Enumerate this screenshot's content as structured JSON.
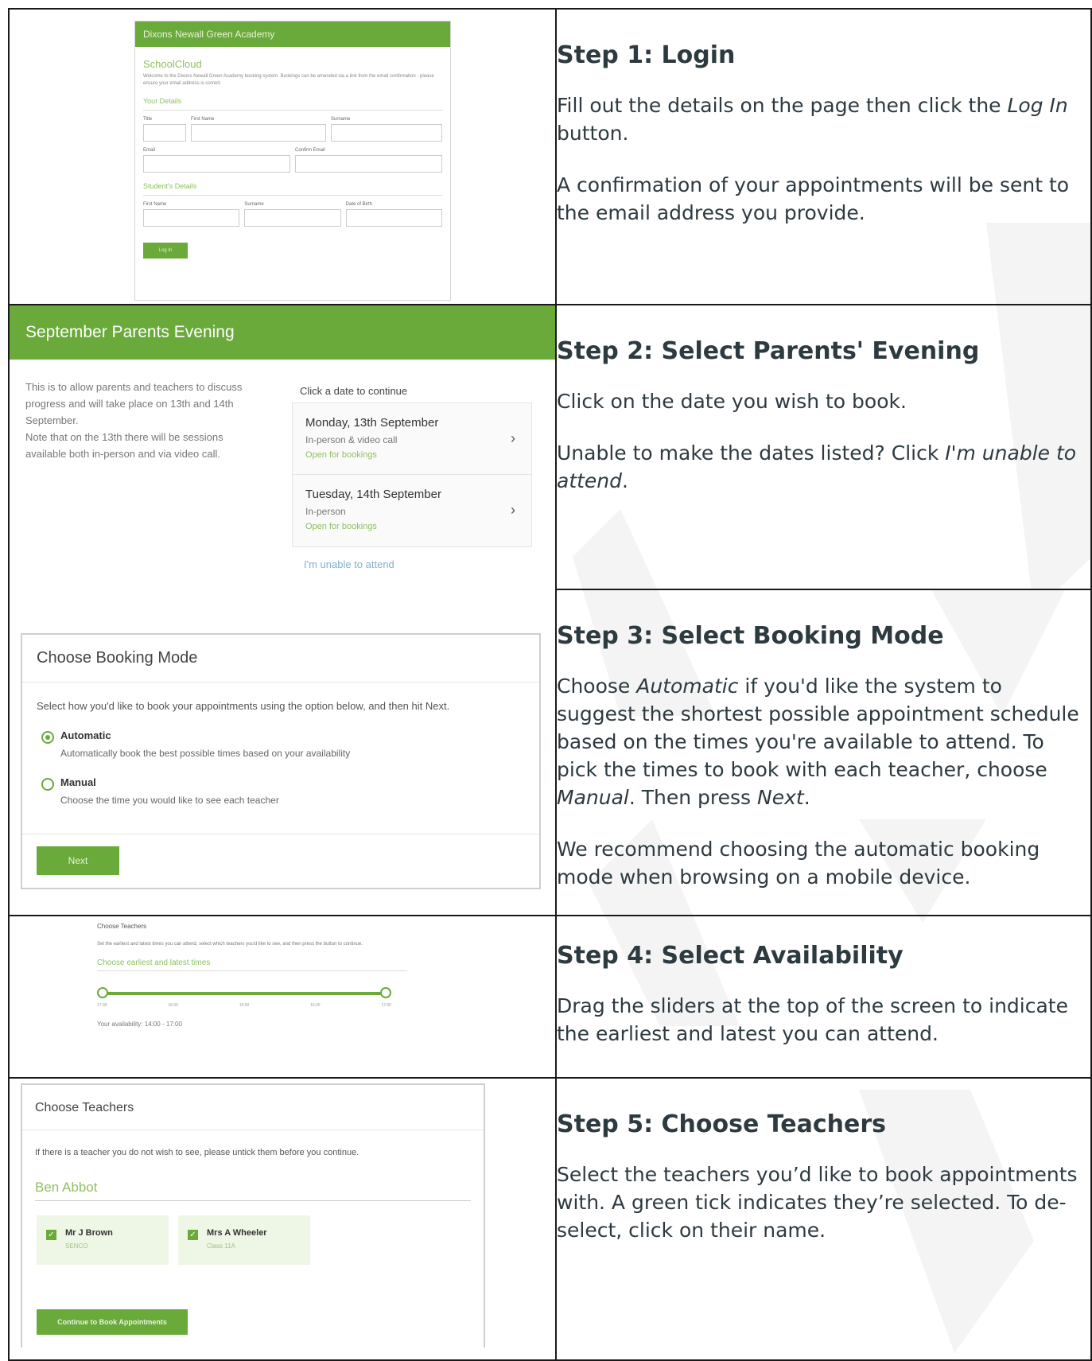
{
  "steps": [
    {
      "title": "Step 1: Login",
      "paragraphs": [
        [
          "Fill out the details on the page then click the ",
          {
            "em": "Log In"
          },
          " button."
        ],
        [
          "A confirmation of your appointments will be sent to the email address you provide."
        ]
      ]
    },
    {
      "title": "Step 2: Select Parents' Evening",
      "paragraphs": [
        [
          "Click on the date you wish to book."
        ],
        [
          "Unable to make the dates listed? Click ",
          {
            "em": "I'm unable to attend"
          },
          "."
        ]
      ]
    },
    {
      "title": "Step 3: Select Booking Mode",
      "paragraphs": [
        [
          "Choose ",
          {
            "em": "Automatic"
          },
          " if you'd like the system to suggest the shortest possible appointment schedule based on the times you're available to attend. To pick the times to book with each teacher, choose ",
          {
            "em": "Manual"
          },
          ". Then press ",
          {
            "em": "Next"
          },
          "."
        ],
        [
          "We recommend choosing the automatic booking mode when browsing on a mobile device."
        ]
      ]
    },
    {
      "title": "Step 4: Select Availability",
      "paragraphs": [
        [
          "Drag the sliders at the top of the screen to indicate the earliest and latest you can attend."
        ]
      ]
    },
    {
      "title": "Step 5: Choose Teachers",
      "paragraphs": [
        [
          "Select the teachers you’d like to book appointments with. A green tick indicates they’re selected. To de-select, click on their name."
        ]
      ]
    }
  ],
  "mock1": {
    "header": "Dixons Newall Green Academy",
    "app": "SchoolCloud",
    "welcome": "Welcome to the Dixons Newall Green Academy booking system. Bookings can be amended via a link from the email confirmation - please ensure your email address is correct.",
    "your_details": "Your Details",
    "title_label": "Title",
    "first_name_label": "First Name",
    "surname_label": "Surname",
    "email_label": "Email",
    "confirm_email_label": "Confirm Email",
    "students_details": "Student's Details",
    "student_first_label": "First Name",
    "student_surname_label": "Surname",
    "dob_label": "Date of Birth",
    "login_button": "Log In"
  },
  "mock2": {
    "header": "September Parents Evening",
    "description": "This is to allow parents and teachers to discuss progress and will take place on 13th and 14th September.\nNote that on the 13th there will be sessions available both in-person and via video call.",
    "click_date": "Click a date to continue",
    "dates": [
      {
        "date": "Monday, 13th September",
        "mode": "In-person & video call",
        "status": "Open for bookings"
      },
      {
        "date": "Tuesday, 14th September",
        "mode": "In-person",
        "status": "Open for bookings"
      }
    ],
    "unable": "I'm unable to attend"
  },
  "mock3": {
    "title": "Choose Booking Mode",
    "instruction": "Select how you'd like to book your appointments using the option below, and then hit Next.",
    "options": [
      {
        "label": "Automatic",
        "desc": "Automatically book the best possible times based on your availability",
        "selected": true
      },
      {
        "label": "Manual",
        "desc": "Choose the time you would like to see each teacher",
        "selected": false
      }
    ],
    "next": "Next"
  },
  "mock4": {
    "title": "Choose Teachers",
    "instruction": "Set the earliest and latest times you can attend, select which teachers you'd like to see, and then press the button to continue.",
    "section": "Choose earliest and latest times",
    "ticks": [
      "17:00",
      "16:00",
      "15:00",
      "16:30",
      "17:00"
    ],
    "availability": "Your availability: 14:00 - 17:00"
  },
  "mock5": {
    "title": "Choose Teachers",
    "instruction": "If there is a teacher you do not wish to see, please untick them before you continue.",
    "child": "Ben Abbot",
    "teachers": [
      {
        "name": "Mr J Brown",
        "role": "SENCO"
      },
      {
        "name": "Mrs A Wheeler",
        "role": "Class 11A"
      }
    ],
    "continue": "Continue to Book Appointments"
  }
}
